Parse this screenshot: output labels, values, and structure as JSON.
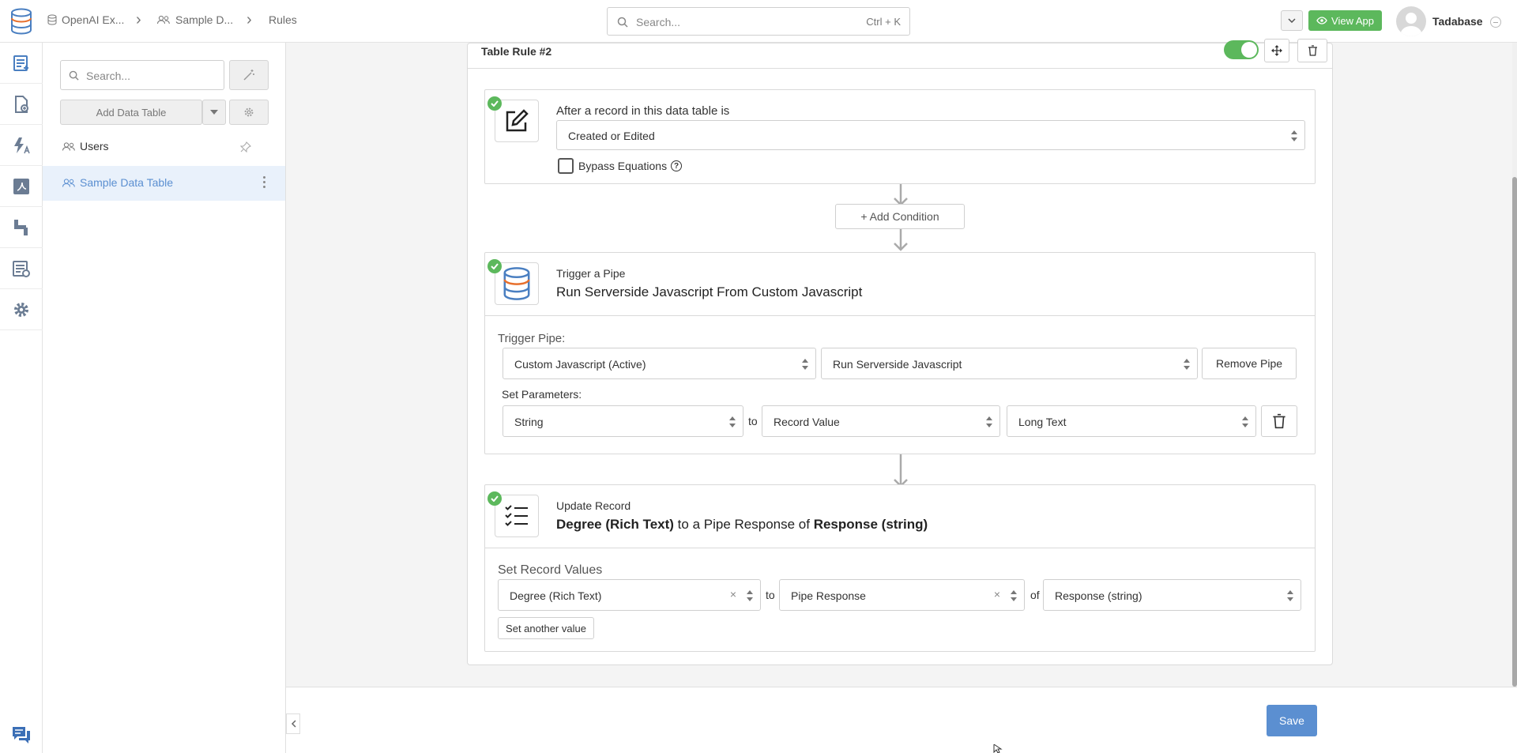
{
  "breadcrumb": [
    "OpenAI Ex...",
    "Sample D...",
    "Rules"
  ],
  "search": {
    "placeholder": "Search...",
    "shortcut": "Ctrl + K"
  },
  "header": {
    "view_app": "View App",
    "user": "Tadabase"
  },
  "sidebar": {
    "search_placeholder": "Search...",
    "add_table": "Add Data Table",
    "tables": [
      {
        "label": "Users",
        "active": false
      },
      {
        "label": "Sample Data Table",
        "active": true
      }
    ]
  },
  "rule": {
    "title": "Table Rule #2",
    "enabled": true,
    "trigger": {
      "label": "After a record in this data table is",
      "value": "Created or Edited",
      "bypass_label": "Bypass Equations"
    },
    "add_condition": "+ Add Condition",
    "pipe": {
      "kicker": "Trigger a Pipe",
      "title": "Run Serverside Javascript From Custom Javascript",
      "trigger_label": "Trigger Pipe:",
      "pipe_select": "Custom Javascript (Active)",
      "action_select": "Run Serverside Javascript",
      "remove": "Remove Pipe",
      "params_label": "Set Parameters:",
      "param_name": "String",
      "to": "to",
      "param_source": "Record Value",
      "param_field": "Long Text"
    },
    "update": {
      "kicker": "Update Record",
      "title_bold1": "Degree (Rich Text)",
      "title_mid": " to a Pipe Response of ",
      "title_bold2": "Response (string)",
      "values_label": "Set Record Values",
      "field": "Degree (Rich Text)",
      "to": "to",
      "source": "Pipe Response",
      "of": "of",
      "response": "Response (string)",
      "another": "Set another value"
    }
  },
  "footer": {
    "save": "Save"
  },
  "colors": {
    "accent": "#5b8fd1",
    "green": "#5cb85c",
    "save": "#5b8fd1"
  }
}
